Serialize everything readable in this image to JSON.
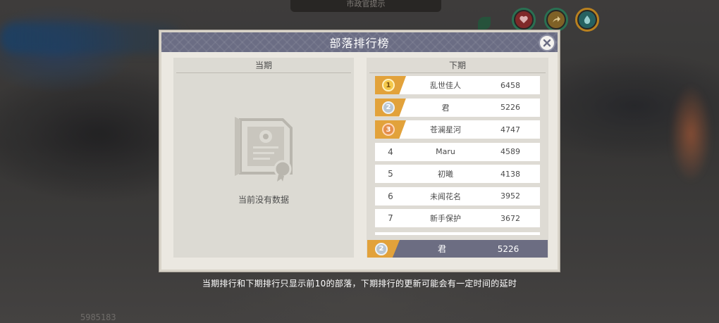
{
  "hud": {
    "top_notice": "市政官提示",
    "uid": "5985183"
  },
  "modal": {
    "title": "部落排行榜",
    "current_period": {
      "heading": "当期",
      "empty_text": "当前没有数据"
    },
    "next_period": {
      "heading": "下期",
      "rows": [
        {
          "rank": "1",
          "name": "乱世佳人",
          "score": "6458",
          "medal": "gold"
        },
        {
          "rank": "2",
          "name": "君",
          "score": "5226",
          "medal": "silver"
        },
        {
          "rank": "3",
          "name": "苍澜星河",
          "score": "4747",
          "medal": "bronze"
        },
        {
          "rank": "4",
          "name": "Maru",
          "score": "4589",
          "medal": ""
        },
        {
          "rank": "5",
          "name": "初曦",
          "score": "4138",
          "medal": ""
        },
        {
          "rank": "6",
          "name": "未闻花名",
          "score": "3952",
          "medal": ""
        },
        {
          "rank": "7",
          "name": "新手保护",
          "score": "3672",
          "medal": ""
        }
      ],
      "my_tribe": {
        "rank": "2",
        "name": "君",
        "score": "5226"
      }
    }
  },
  "footer": {
    "note": "当期排行和下期排行只显示前10的部落，下期排行的更新可能会有一定时间的延时"
  },
  "colors": {
    "header": "#6b6d84",
    "badge": "#e2a23b",
    "panel": "#dcdad3"
  }
}
